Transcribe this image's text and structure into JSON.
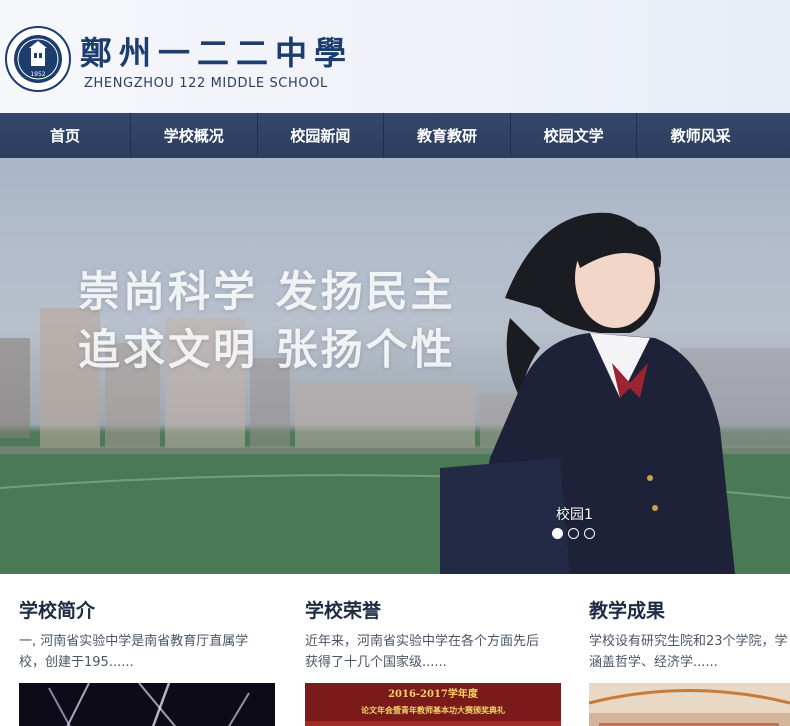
{
  "header": {
    "logo_cn": "鄭州一二二中學",
    "logo_en": "ZHENGZHOU 122 MIDDLE SCHOOL",
    "seal_year": "1952"
  },
  "nav": {
    "items": [
      {
        "label": "首页"
      },
      {
        "label": "学校概况"
      },
      {
        "label": "校园新闻"
      },
      {
        "label": "教育教研"
      },
      {
        "label": "校园文学"
      },
      {
        "label": "教师风采"
      }
    ]
  },
  "banner": {
    "slogan_line1": "崇尚科学  发扬民主",
    "slogan_line2": "追求文明  张扬个性",
    "caption": "校园1",
    "active_slide": 1,
    "slide_count": 3
  },
  "sections": [
    {
      "title": "学校简介",
      "text_line1": "一, 河南省实验中学是南省教育厅直属学",
      "text_line2": "校，创建于195......"
    },
    {
      "title": "学校荣誉",
      "text_line1": "近年来，河南省实验中学在各个方面先后",
      "text_line2": "获得了十几个国家级......",
      "thumb_text1": "2016-2017学年度",
      "thumb_text2": "论文年会暨青年教师基本功大赛颁奖典礼"
    },
    {
      "title": "教学成果",
      "text_line1": "学校设有研究生院和23个学院，学",
      "text_line2": "涵盖哲学、经济学......"
    }
  ],
  "colors": {
    "nav_bg": "#2f4263",
    "title_text": "#1d2b44",
    "logo_blue": "#1c3d6e"
  }
}
